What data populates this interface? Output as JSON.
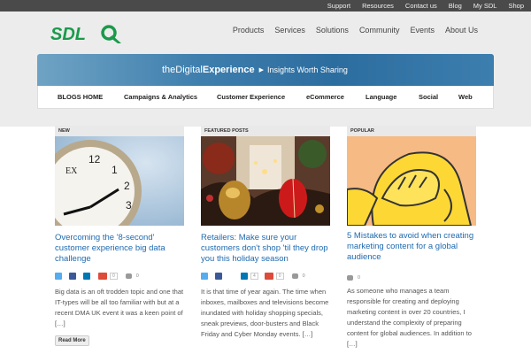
{
  "topbar": {
    "links": [
      "Support",
      "Resources",
      "Contact us",
      "Blog",
      "My SDL",
      "Shop"
    ]
  },
  "logo": {
    "text": "SDL"
  },
  "mainnav": {
    "items": [
      "Products",
      "Services",
      "Solutions",
      "Community",
      "Events",
      "About Us"
    ]
  },
  "banner": {
    "the": "the",
    "digital": "Digital",
    "experience": "Experience",
    "tagline": "Insights Worth Sharing"
  },
  "catnav": {
    "items": [
      "BLOGS HOME",
      "Campaigns & Analytics",
      "Customer Experience",
      "eCommerce",
      "Language",
      "Social",
      "Web"
    ]
  },
  "posts": [
    {
      "label": "NEW",
      "title": "Overcoming the '8-second' customer experience big data challenge",
      "excerpt": "Big data is an oft trodden topic and one that IT-types will be all too familiar with but at a recent DMA UK event it was a keen point of […]",
      "gplus_count": "0",
      "comments": "0",
      "read_more": "Read More"
    },
    {
      "label": "FEATURED POSTS",
      "title": "Retailers: Make sure your customers don't shop 'til they drop you this holiday season",
      "excerpt": "It is that time of year again. The time when inboxes, mailboxes and televisions become inundated with holiday shopping specials, sneak previews, door-busters and Black Friday and Cyber Monday events. […]",
      "linkedin_count": "4",
      "gplus_count": "0",
      "comments": "0"
    },
    {
      "label": "POPULAR",
      "title": "5 Mistakes to avoid when creating marketing content for a global audience",
      "excerpt": "As someone who manages a team responsible for creating and deploying marketing content in over 20 countries, I understand the complexity of preparing content for global audiences.  In addition to […]",
      "comments": "0"
    }
  ],
  "colors": {
    "accent_green": "#1a9a4a",
    "link_blue": "#1e6ab0",
    "banner_blue": "#2c6d9f"
  }
}
